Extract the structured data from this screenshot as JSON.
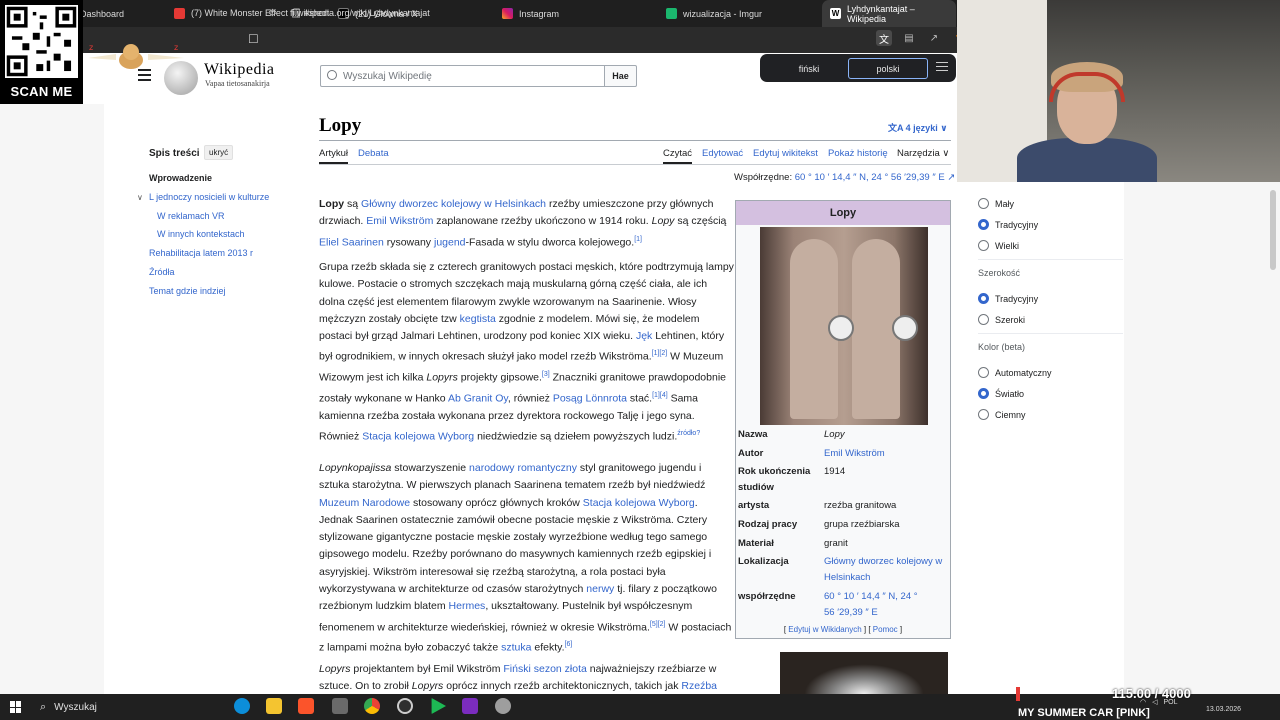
{
  "browser": {
    "tabs": [
      {
        "label": "Dashboard",
        "icon": "dashboard-icon"
      },
      {
        "label": "(7) White Monster Effect 🗒 #short",
        "icon": "youtube-icon"
      },
      {
        "label": "(21) Główna / X",
        "icon": "x-icon"
      },
      {
        "label": "Instagram",
        "icon": "instagram-icon"
      },
      {
        "label": "wizualizacja - Imgur",
        "icon": "imgur-icon"
      },
      {
        "label": "Lyhdynkantajat – Wikipedia",
        "icon": "wikipedia-icon"
      }
    ],
    "url": "fi.wikipedia.org/wiki/Lyhdynkantajat"
  },
  "overlay": {
    "scan_me": "SCAN ME",
    "counter": "115.00 / 4000",
    "game": "MY SUMMER CAR [PINK]"
  },
  "translate": {
    "source_lang": "fiński",
    "target_lang": "polski"
  },
  "wiki": {
    "wordmark": "Wikipedia",
    "tagline": "Vapaa tietosanakirja",
    "search_placeholder": "Wyszukaj Wikipedię",
    "search_button": "Hae"
  },
  "toc": {
    "title": "Spis treści",
    "hide": "ukryć",
    "items": [
      "Wprowadzenie",
      "L jednoczy nosicieli w kulturze",
      "W reklamach VR",
      "W innych kontekstach",
      "Rehabilitacja latem 2013 r",
      "Źródła",
      "Temat gdzie indziej"
    ]
  },
  "article": {
    "title": "Lopy",
    "languages": "4 języki",
    "tabs": {
      "article": "Artykuł",
      "talk": "Debata",
      "read": "Czytać",
      "edit": "Edytować",
      "edit_source": "Edytuj wikitekst",
      "history": "Pokaż historię",
      "tools": "Narzędzia"
    },
    "coords_label": "Współrzędne:",
    "coords_value": "60 ° 10 ′ 14,4 ″ N, 24 ° 56 ′29,39 ″ E",
    "p1": {
      "a": "Lopy",
      "b": " są ",
      "c": "Główny dworzec kolejowy w Helsinkach",
      "d": " rzeźby umieszczone przy głównych drzwiach. ",
      "e": "Emil Wikström",
      "f": " zaplanowane rzeźby ukończono w 1914 roku. ",
      "g": "Lopy",
      "h": " są częścią ",
      "i": "Eliel Saarinen",
      "j": " rysowany ",
      "k": "jugend",
      "l": "-Fasada w stylu dworca kolejowego.",
      "m": "[1]"
    },
    "p2": {
      "a": "Grupa rzeźb składa się z czterech granitowych postaci męskich, które podtrzymują lampy kulowe. Postacie o stromych szczękach mają muskularną górną część ciała, ale ich dolna część jest elementem filarowym zwykle wzorowanym na Saarinenie. Włosy mężczyzn zostały obcięte tzw ",
      "b": "kegtista",
      "c": " zgodnie z modelem. Mówi się, że modelem postaci był grząd Jalmari Lehtinen, urodzony pod koniec XIX wieku. ",
      "d": "Jęk",
      "e": " Lehtinen, który był ogrodnikiem, w innych okresach służył jako model rzeźb Wikströma.",
      "f": "[1][2]",
      "g": " W Muzeum Wizowym jest ich kilka ",
      "h": "Lopyrs",
      "i": " projekty gipsowe.",
      "j": "[3]",
      "k": " Znaczniki granitowe prawdopodobnie zostały wykonane w Hanko ",
      "l": "Ab Granit Oy",
      "m": ", również ",
      "n": "Posąg Lönnrota",
      "o": " stać.",
      "p": "[1][4]",
      "q": " Sama kamienna rzeźba została wykonana przez dyrektora rockowego Talję i jego syna. Również ",
      "r": "Stacja kolejowa Wyborg",
      "s": " niedźwiedzie są dziełem powyższych ludzi.",
      "t": "źródło?"
    },
    "p3": {
      "a": "Lopynkopajissa",
      "b": " stowarzyszenie ",
      "c": "narodowy romantyczny",
      "d": " styl granitowego jugendu i sztuka starożytna. W pierwszych planach Saarinena tematem rzeźb był niedźwiedź ",
      "e": "Muzeum Narodowe",
      "f": " stosowany oprócz głównych kroków ",
      "g": "Stacja kolejowa Wyborg",
      "h": ". Jednak Saarinen ostatecznie zamówił obecne postacie męskie z Wikströma. Cztery stylizowane gigantyczne postacie męskie zostały wyrzeźbione według tego samego gipsowego modelu. Rzeźby porównano do masywnych kamiennych rzeźb egipskiej i asyryjskiej. Wikström interesował się rzeźbą starożytną, a rola postaci była wykorzystywana w architekturze od czasów starożytnych ",
      "i": "nerwy",
      "j": " tj. filary z początkowo rzeźbionym ludzkim blatem ",
      "k": "Hermes",
      "l": ", ukształtowany. Pustelnik był współczesnym fenomenem w architekturze wiedeńskiej, również w okresie Wikströma.",
      "m": "[5][2]",
      "n": " W postaciach z lampami można było zobaczyć także ",
      "o": "sztuka",
      "p": " efekty.",
      "q": "[6]"
    },
    "p4": {
      "a": "Lopyrs",
      "b": " projektantem był Emil Wikström ",
      "c": "Fiński sezon złota",
      "d": " najważniejszy rzeźbiarze w sztuce. On to zrobił ",
      "e": "Lopyrs",
      "f": " oprócz innych rzeźb architektonicznych, takich jak ",
      "g": "Rzeźba niedźwiedzia"
    }
  },
  "infobox": {
    "title": "Lopy",
    "rows": [
      {
        "label": "Nazwa",
        "value": "Lopy"
      },
      {
        "label": "Autor",
        "value": "Emil Wikström"
      },
      {
        "label": "Rok ukończenia studiów",
        "value": "1914"
      },
      {
        "label": "artysta",
        "value": "rzeźba granitowa"
      },
      {
        "label": "Rodzaj pracy",
        "value": "grupa rzeźbiarska"
      },
      {
        "label": "Materiał",
        "value": "granit"
      },
      {
        "label": "Lokalizacja",
        "value": "Główny dworzec kolejowy w Helsinkach"
      },
      {
        "label": "współrzędne",
        "value": "60 ° 10 ′ 14,4 ″ N, 24 ° 56 ′29,39 ″ E"
      }
    ],
    "footer_open": "[ ",
    "footer_edit": "Edytuj w Wikidanych",
    "footer_sep": " ] [ ",
    "footer_help": "Pomoc",
    "footer_close": " ]"
  },
  "appearance": {
    "size": [
      "Mały",
      "Tradycyjny",
      "Wielki"
    ],
    "width_head": "Szerokość",
    "width": [
      "Tradycyjny",
      "Szeroki"
    ],
    "color_head": "Kolor (beta)",
    "color": [
      "Automatyczny",
      "Światło",
      "Ciemny"
    ]
  },
  "taskbar": {
    "search": "Wyszukaj",
    "lang": "POL",
    "date": "13.03.2026"
  }
}
